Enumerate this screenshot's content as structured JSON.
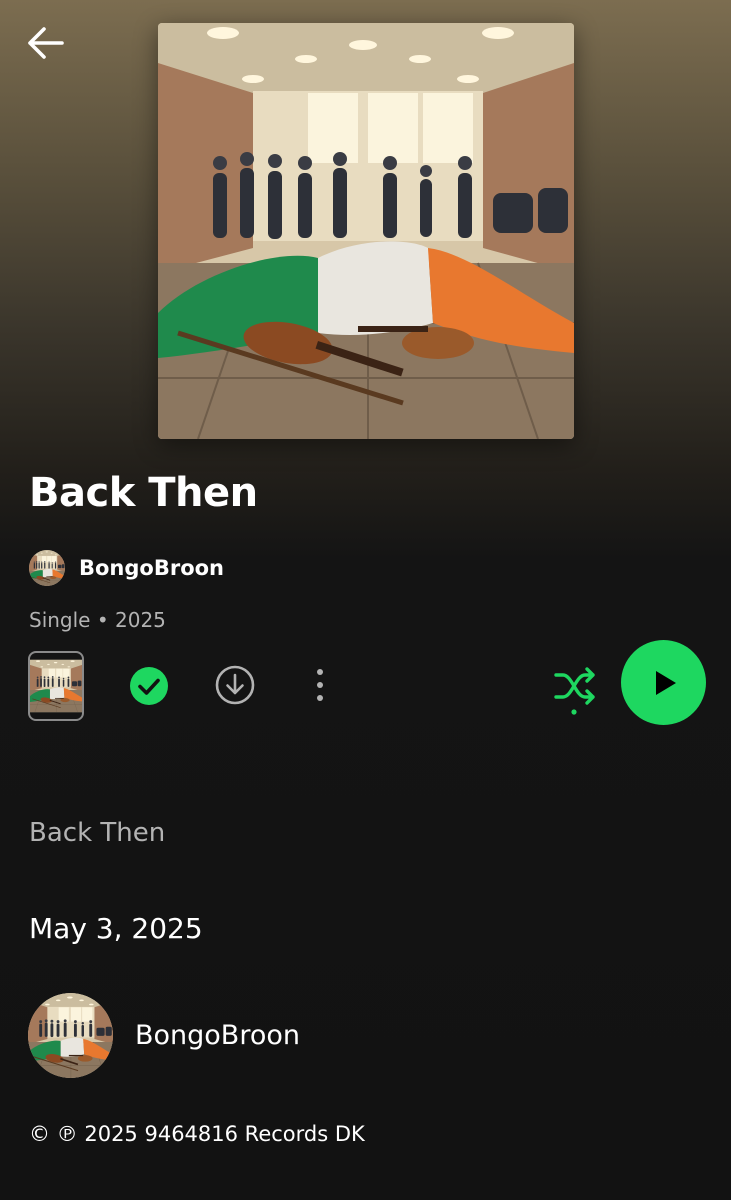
{
  "header": {
    "back_icon": "arrow-left-icon"
  },
  "album": {
    "cover_description_icon": "album-cover-art",
    "title": "Back Then",
    "artist": "BongoBroon",
    "meta": "Single • 2025"
  },
  "controls": {
    "saved_icon": "check-circle-icon",
    "download_icon": "download-icon",
    "more_icon": "more-vertical-icon",
    "shuffle_icon": "shuffle-icon",
    "play_icon": "play-icon"
  },
  "tracks": [
    {
      "name": "Back Then"
    }
  ],
  "release": {
    "date": "May 3, 2025"
  },
  "artist_card": {
    "name": "BongoBroon"
  },
  "footer": {
    "copyright": "© ℗ 2025 9464816 Records DK"
  },
  "colors": {
    "accent": "#1ed760",
    "background": "#121212",
    "secondary_text": "#b3b3b3"
  }
}
